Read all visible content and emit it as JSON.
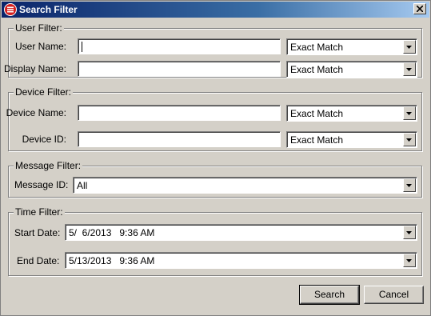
{
  "window": {
    "title": "Search Filter"
  },
  "user_filter": {
    "legend": "User Filter:",
    "user_name": {
      "label": "User Name:",
      "value": "",
      "match": "Exact Match"
    },
    "display_name": {
      "label": "Display Name:",
      "value": "",
      "match": "Exact Match"
    }
  },
  "device_filter": {
    "legend": "Device Filter:",
    "device_name": {
      "label": "Device Name:",
      "value": "",
      "match": "Exact Match"
    },
    "device_id": {
      "label": "Device ID:",
      "value": "",
      "match": "Exact Match"
    }
  },
  "message_filter": {
    "legend": "Message Filter:",
    "message_id": {
      "label": "Message ID:",
      "value": "All"
    }
  },
  "time_filter": {
    "legend": "Time Filter:",
    "start_date": {
      "label": "Start Date:",
      "value": "5/  6/2013   9:36 AM"
    },
    "end_date": {
      "label": "End Date:",
      "value": "5/13/2013   9:36 AM"
    }
  },
  "buttons": {
    "search": "Search",
    "cancel": "Cancel"
  }
}
